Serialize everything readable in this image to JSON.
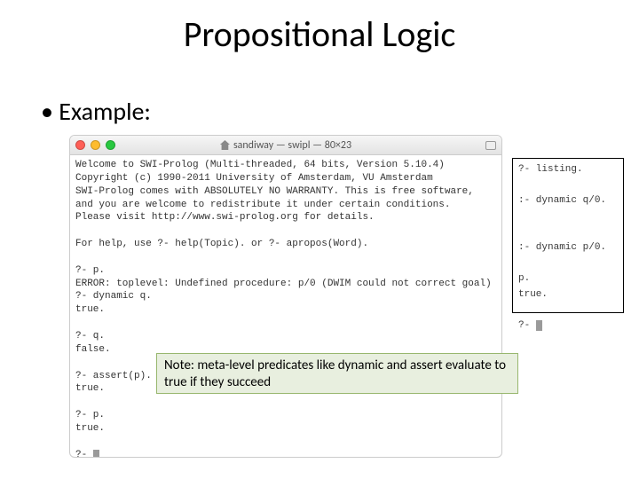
{
  "title": "Propositional Logic",
  "bullet": "Example:",
  "terminal": {
    "window_title": "sandiway — swipl — 80×23",
    "lines": [
      "Welcome to SWI-Prolog (Multi-threaded, 64 bits, Version 5.10.4)",
      "Copyright (c) 1990-2011 University of Amsterdam, VU Amsterdam",
      "SWI-Prolog comes with ABSOLUTELY NO WARRANTY. This is free software,",
      "and you are welcome to redistribute it under certain conditions.",
      "Please visit http://www.swi-prolog.org for details.",
      "",
      "For help, use ?- help(Topic). or ?- apropos(Word).",
      "",
      "?- p.",
      "ERROR: toplevel: Undefined procedure: p/0 (DWIM could not correct goal)",
      "?- dynamic q.",
      "true.",
      "",
      "?- q.",
      "false.",
      "",
      "?- assert(p).",
      "true.",
      "",
      "?- p.",
      "true.",
      "",
      "?- "
    ]
  },
  "sidebox": {
    "lines": [
      "?- listing.",
      "",
      ":- dynamic q/0.",
      "",
      "",
      ":- dynamic p/0.",
      "",
      "p.",
      "true.",
      "",
      "?- "
    ]
  },
  "note": {
    "prefix": "Note: meta-level predicates like ",
    "kw1": "dynamic",
    "mid": " and ",
    "kw2": "assert",
    "suffix": " evaluate to true if they succeed"
  }
}
